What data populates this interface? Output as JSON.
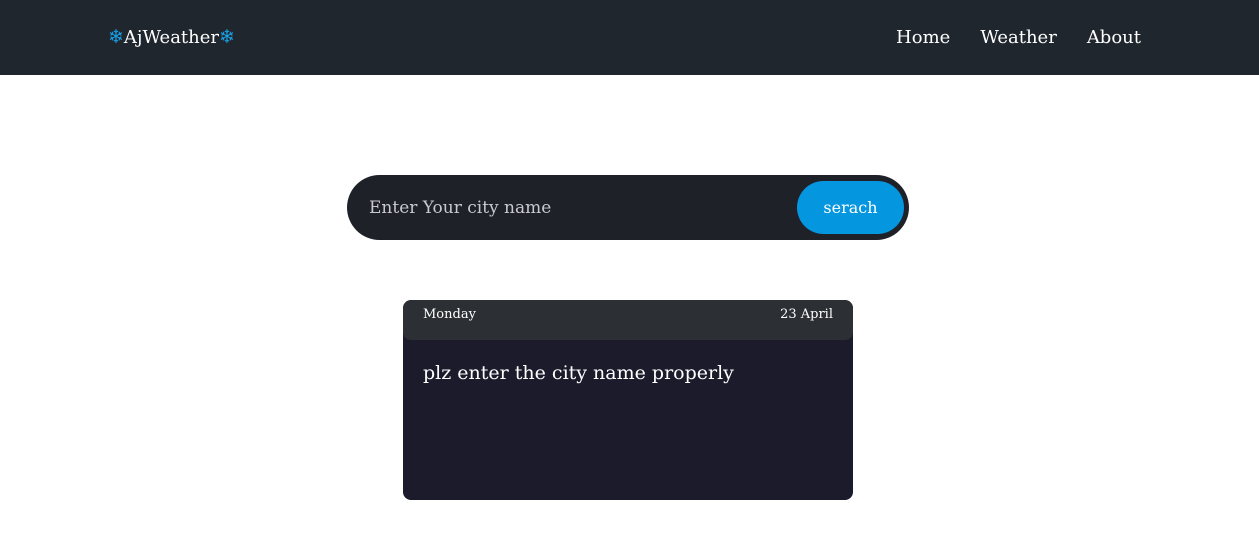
{
  "navbar": {
    "brand": {
      "prefix_icon": "snowflake-icon",
      "name": "AjWeather",
      "suffix_icon": "snowflake-icon",
      "snowflake_glyph": "❄",
      "icon_color": "#1aa0e6"
    },
    "links": [
      {
        "label": "Home"
      },
      {
        "label": "Weather"
      },
      {
        "label": "About"
      }
    ],
    "background_color": "#1f262e"
  },
  "search": {
    "placeholder": "Enter Your city name",
    "value": "",
    "button_label": "serach",
    "button_color": "#0596e0"
  },
  "card": {
    "day": "Monday",
    "date": "23 April",
    "message": "plz enter the city name properly"
  }
}
